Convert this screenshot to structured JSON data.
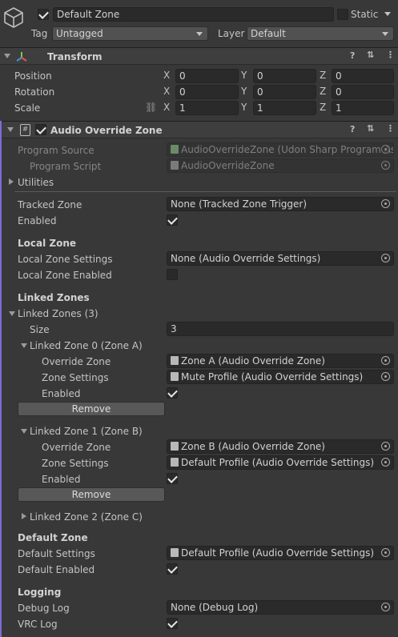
{
  "header": {
    "object_name": "Default Zone",
    "static_label": "Static",
    "tag_label": "Tag",
    "tag_value": "Untagged",
    "layer_label": "Layer",
    "layer_value": "Default"
  },
  "transform": {
    "title": "Transform",
    "rows": [
      {
        "label": "Position",
        "x": "0",
        "y": "0",
        "z": "0"
      },
      {
        "label": "Rotation",
        "x": "0",
        "y": "0",
        "z": "0"
      },
      {
        "label": "Scale",
        "x": "1",
        "y": "1",
        "z": "1"
      }
    ],
    "axis_x": "X",
    "axis_y": "Y",
    "axis_z": "Z"
  },
  "component": {
    "title": "Audio Override Zone",
    "program_source_label": "Program Source",
    "program_source_value": "AudioOverrideZone (Udon Sharp Program As",
    "program_script_label": "Program Script",
    "program_script_value": "AudioOverrideZone",
    "utilities_label": "Utilities",
    "tracked_zone_label": "Tracked Zone",
    "tracked_zone_value": "None (Tracked Zone Trigger)",
    "enabled_label": "Enabled",
    "local_zone_heading": "Local Zone",
    "local_zone_settings_label": "Local Zone Settings",
    "local_zone_settings_value": "None (Audio Override Settings)",
    "local_zone_enabled_label": "Local Zone Enabled",
    "linked_zones_heading": "Linked Zones",
    "linked_zones_label": "Linked Zones (3)",
    "size_label": "Size",
    "size_value": "3",
    "zones": [
      {
        "title": "Linked Zone 0 (Zone A)",
        "override_label": "Override Zone",
        "override_value": "Zone A (Audio Override Zone)",
        "settings_label": "Zone Settings",
        "settings_value": "Mute Profile (Audio Override Settings)",
        "enabled_label": "Enabled",
        "remove_label": "Remove"
      },
      {
        "title": "Linked Zone 1 (Zone B)",
        "override_label": "Override Zone",
        "override_value": "Zone B (Audio Override Zone)",
        "settings_label": "Zone Settings",
        "settings_value": "Default Profile (Audio Override Settings)",
        "enabled_label": "Enabled",
        "remove_label": "Remove"
      },
      {
        "title": "Linked Zone 2 (Zone C)"
      }
    ],
    "default_zone_heading": "Default Zone",
    "default_settings_label": "Default Settings",
    "default_settings_value": "Default Profile (Audio Override Settings)",
    "default_enabled_label": "Default Enabled",
    "logging_heading": "Logging",
    "debug_log_label": "Debug Log",
    "debug_log_value": "None (Debug Log)",
    "vrc_log_label": "VRC Log"
  },
  "icons": [
    "cube-icon",
    "transform-axes-icon",
    "script-icon",
    "help-icon",
    "presets-icon",
    "kebab-menu-icon",
    "link-icon",
    "object-picker-icon"
  ],
  "colors": {
    "background": "#383838",
    "field": "#2a2a2a",
    "component_accent": "#7c6dd6"
  }
}
